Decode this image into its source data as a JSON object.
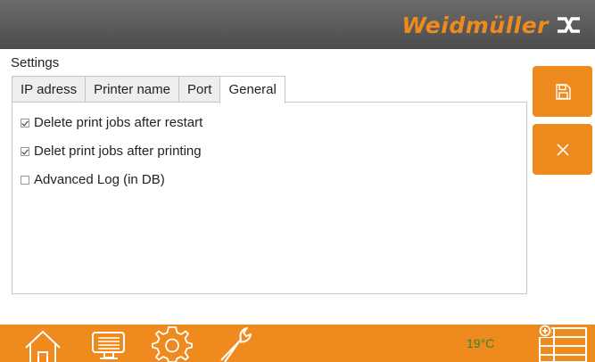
{
  "brand": {
    "name": "Weidmüller"
  },
  "page": {
    "title": "Settings"
  },
  "tabs": [
    {
      "label": "IP adress",
      "active": false
    },
    {
      "label": "Printer name",
      "active": false
    },
    {
      "label": "Port",
      "active": false
    },
    {
      "label": "General",
      "active": true
    }
  ],
  "options": [
    {
      "label": "Delete print jobs after restart",
      "checked": true
    },
    {
      "label": "Delet print jobs after printing",
      "checked": true
    },
    {
      "label": "Advanced Log (in DB)",
      "checked": false
    }
  ],
  "sidebar": {
    "save_icon": "save-icon",
    "cancel_icon": "close-icon"
  },
  "status": {
    "temperature": "19°C"
  },
  "nav": [
    "home-icon",
    "monitor-icon",
    "gear-icon",
    "wrench-icon",
    "grid-menu-icon"
  ],
  "colors": {
    "accent": "#ee8a1e",
    "header": "#5a5a5a",
    "temperature": "#2f8a2f"
  }
}
